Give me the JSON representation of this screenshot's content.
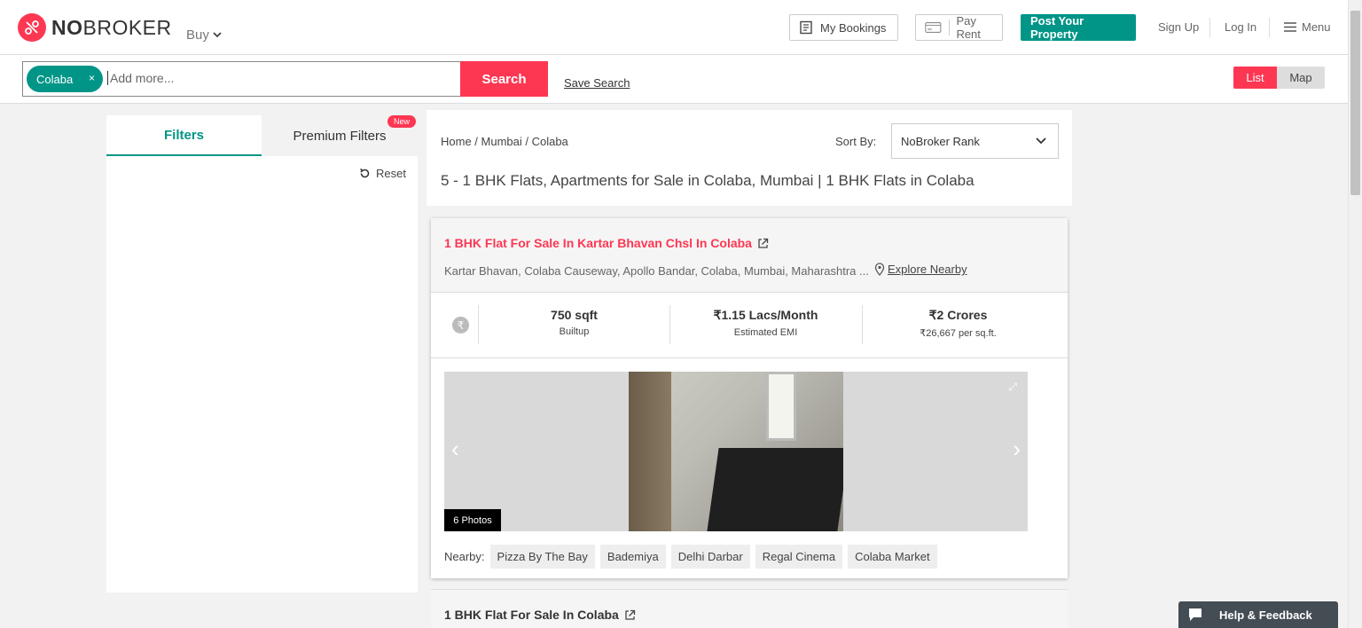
{
  "header": {
    "logo_bold": "NO",
    "logo_rest": "BROKER",
    "buy_label": "Buy",
    "my_bookings": "My Bookings",
    "pay_rent": "Pay Rent",
    "post_property": "Post Your Property",
    "sign_up": "Sign Up",
    "log_in": "Log In",
    "menu": "Menu"
  },
  "search": {
    "chip_label": "Colaba",
    "chip_close": "×",
    "placeholder": "Add more...",
    "button": "Search",
    "save_search": "Save Search"
  },
  "view_toggle": {
    "list": "List",
    "map": "Map",
    "active": "List"
  },
  "filters": {
    "tab_filters": "Filters",
    "tab_premium": "Premium Filters",
    "new_badge": "New",
    "reset": "Reset"
  },
  "results": {
    "breadcrumb": "Home  / Mumbai / Colaba",
    "sort_label": "Sort By:",
    "sort_value": "NoBroker Rank",
    "title": "5 - 1 BHK Flats, Apartments for Sale in Colaba, Mumbai | 1 BHK Flats in Colaba"
  },
  "listings": [
    {
      "title": "1 BHK Flat For Sale In Kartar Bhavan Chsl In Colaba",
      "address": "Kartar Bhavan, Colaba Causeway, Apollo Bandar, Colaba, Mumbai, Maharashtra ...",
      "explore": "Explore Nearby",
      "rupee_icon": "₹",
      "stats": [
        {
          "value": "750 sqft",
          "label": "Builtup"
        },
        {
          "value": "₹1.15 Lacs/Month",
          "label": "Estimated EMI"
        },
        {
          "value": "₹2 Crores",
          "label": "₹26,667 per sq.ft."
        }
      ],
      "photos": "6 Photos",
      "nearby_label": "Nearby:",
      "nearby": [
        "Pizza By The Bay",
        "Bademiya",
        "Delhi Darbar",
        "Regal Cinema",
        "Colaba Market"
      ]
    },
    {
      "title": "1 BHK Flat For Sale In Colaba"
    }
  ],
  "help": {
    "label": "Help & Feedback"
  },
  "colors": {
    "brand_red": "#fd3752",
    "brand_teal": "#009587"
  }
}
